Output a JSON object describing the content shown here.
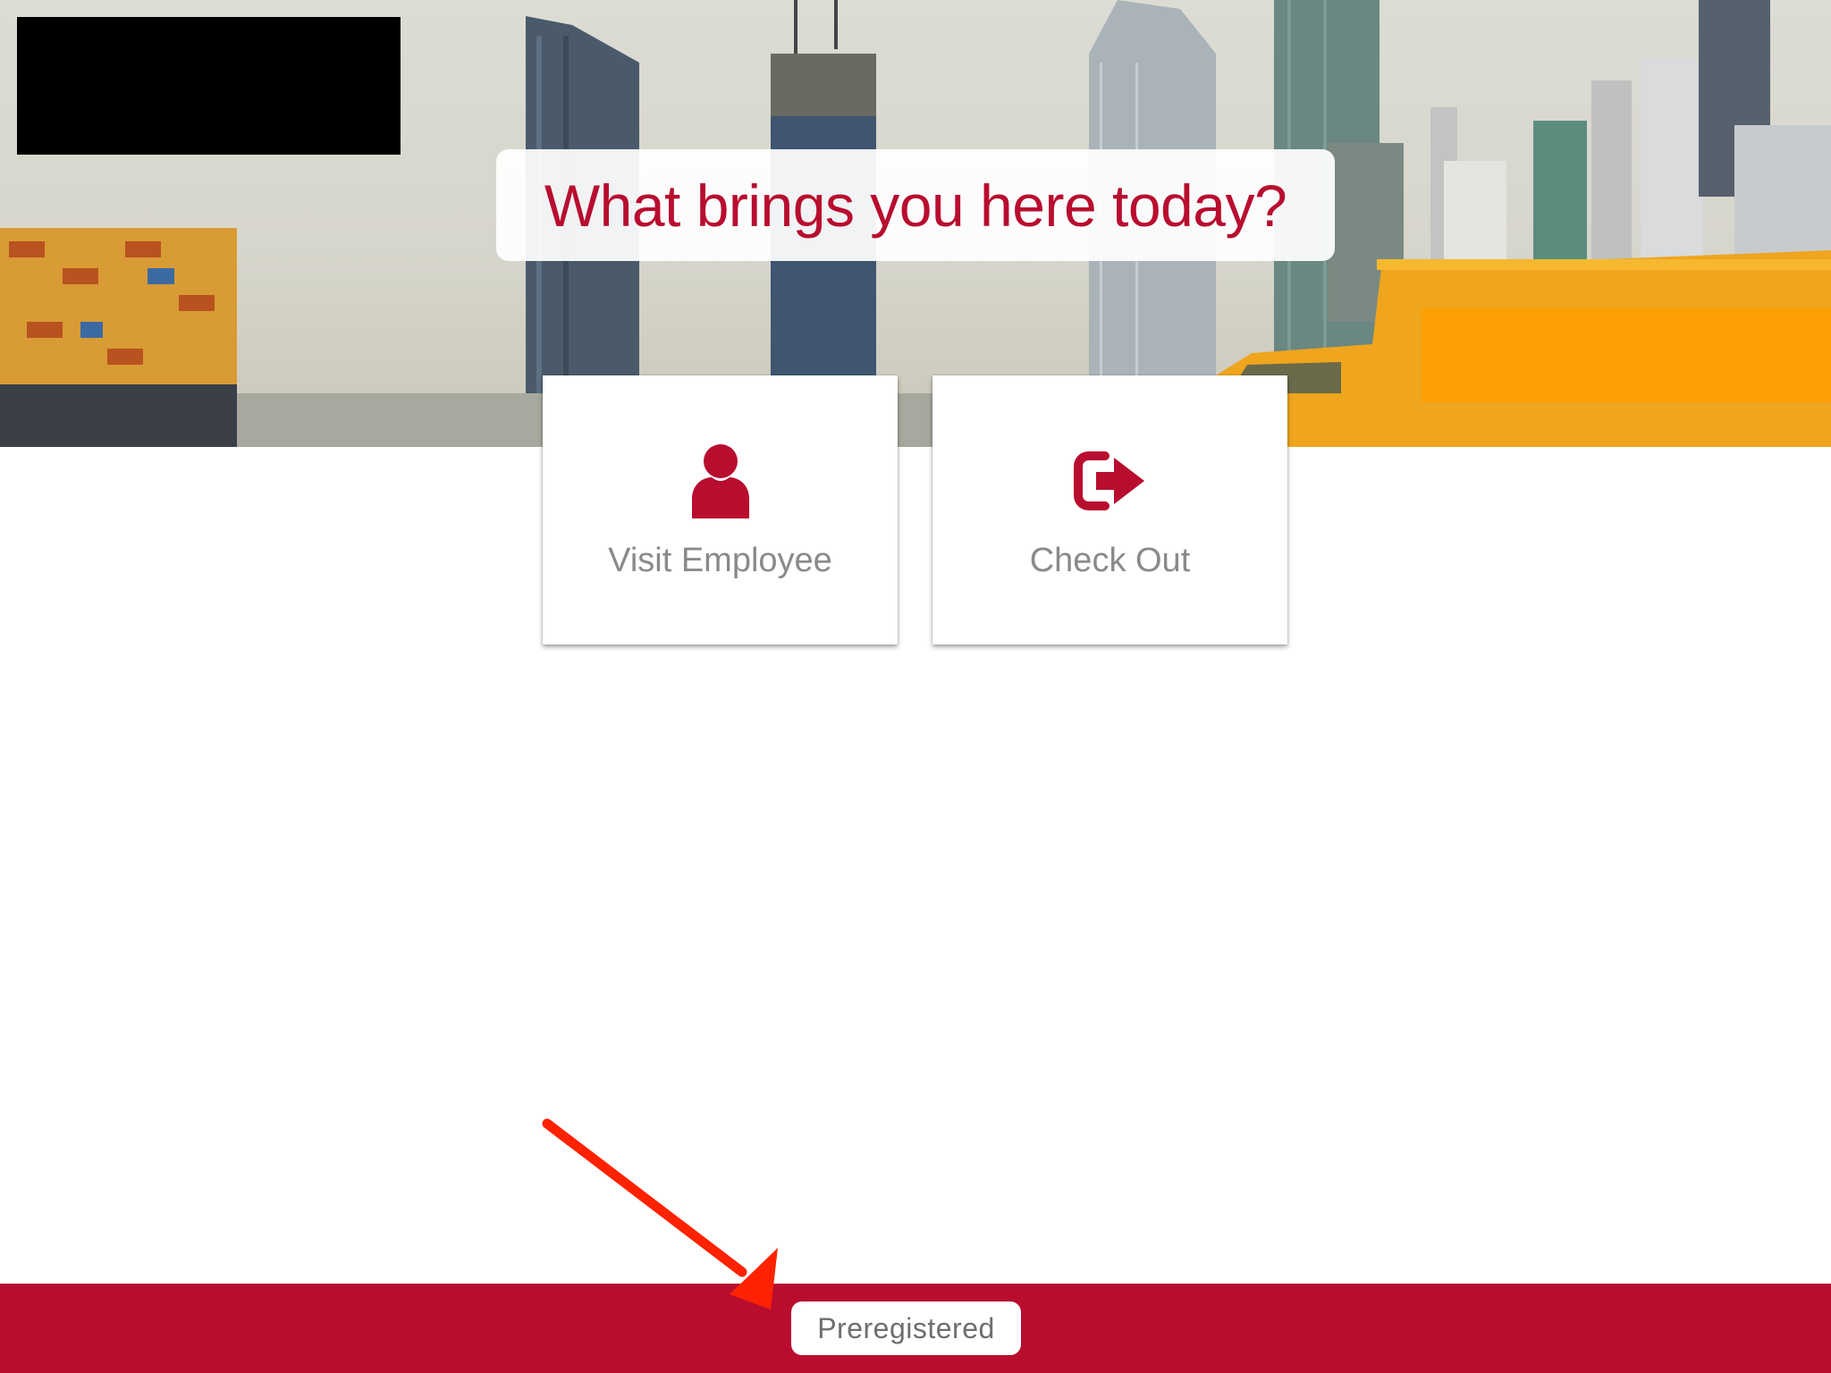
{
  "header": {
    "prompt": "What brings you here today?"
  },
  "options": [
    {
      "label": "Visit Employee",
      "icon": "person-icon"
    },
    {
      "label": "Check Out",
      "icon": "sign-out-icon"
    }
  ],
  "footer": {
    "preregistered_label": "Preregistered"
  },
  "colors": {
    "brand": "#b80d2f",
    "label_gray": "#8a8a8a",
    "arrow": "#ff2200"
  }
}
